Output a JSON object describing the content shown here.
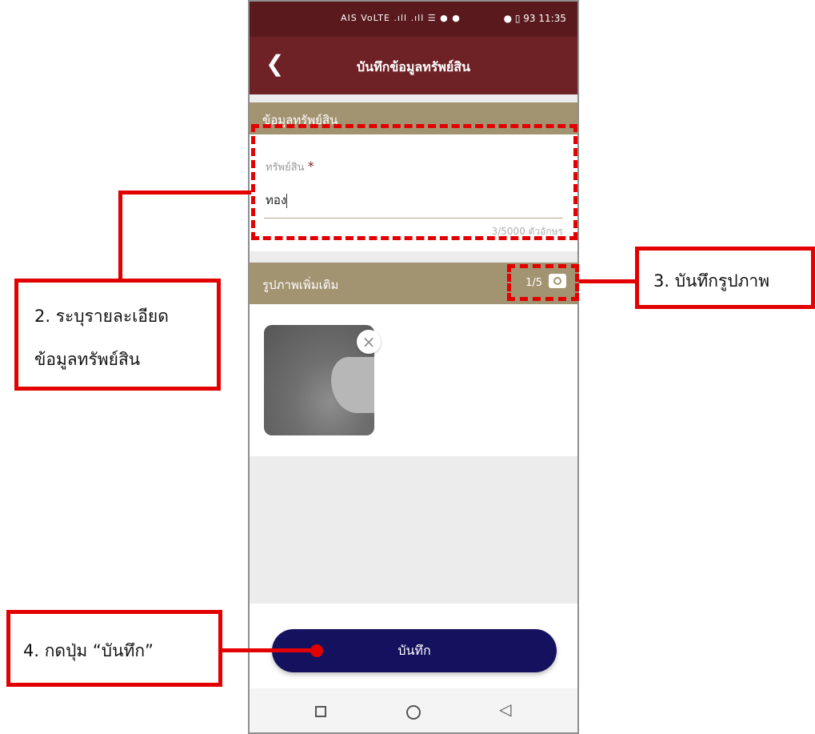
{
  "status_bar": {
    "left_icons": "AIS VoLTE .ıll .ıll ☰ ● ●",
    "right_icons": "● ▯ 93",
    "time": "11:35"
  },
  "app_bar": {
    "back_icon": "chevron-left-icon",
    "title": "บันทึกข้อมูลทรัพย์สิน"
  },
  "asset_section": {
    "header": "ข้อมูลทรัพย์สิน",
    "field_label": "ทรัพย์สิน",
    "required_mark": "*",
    "field_value": "ทอง",
    "char_count": "3/5000 ตัวอักษร"
  },
  "photo_section": {
    "header": "รูปภาพเพิ่มเติม",
    "counter": "1/5",
    "camera_icon": "camera-icon",
    "remove_icon": "×"
  },
  "save_button": {
    "label": "บันทึก"
  },
  "annotations": {
    "step2_line1": "2. ระบุรายละเอียด",
    "step2_line2": "ข้อมูลทรัพย์สิน",
    "step3": "3. บันทึกรูปภาพ",
    "step4": "4. กดปุ่ม “บันทึก”",
    "accent_color": "#e30000"
  },
  "colors": {
    "status_bar": "#5a1a1d",
    "app_bar": "#6f2226",
    "section_header": "#a29371",
    "save_button": "#14125e"
  }
}
